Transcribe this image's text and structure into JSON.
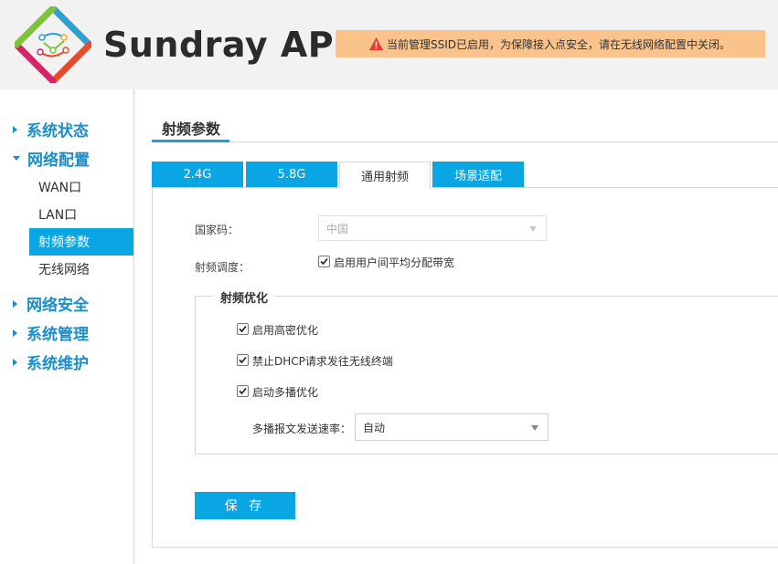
{
  "header": {
    "app_title": "Sundray AP",
    "warning_text": "当前管理SSID已启用，为保障接入点安全，请在无线网络配置中关闭。",
    "logo_icon": "sundray-logo-icon",
    "warning_icon": "warning-triangle-icon"
  },
  "sidebar": {
    "groups": [
      {
        "label": "系统状态",
        "expanded": false
      },
      {
        "label": "网络配置",
        "expanded": true
      },
      {
        "label": "网络安全",
        "expanded": false
      },
      {
        "label": "系统管理",
        "expanded": false
      },
      {
        "label": "系统维护",
        "expanded": false
      }
    ],
    "sub_items": [
      {
        "label": "WAN口",
        "active": false
      },
      {
        "label": "LAN口",
        "active": false
      },
      {
        "label": "射频参数",
        "active": true
      },
      {
        "label": "无线网络",
        "active": false
      }
    ]
  },
  "main": {
    "title": "射频参数",
    "tabs": [
      {
        "label": "2.4G",
        "selected": false
      },
      {
        "label": "5.8G",
        "selected": false
      },
      {
        "label": "通用射频",
        "selected": true
      },
      {
        "label": "场景适配",
        "selected": false
      }
    ],
    "form": {
      "country_label": "国家码：",
      "country_value": "中国",
      "scheduling_label": "射频调度：",
      "scheduling_checkbox": {
        "label": "启用用户间平均分配带宽",
        "checked": true
      },
      "optimization": {
        "legend": "射频优化",
        "options": [
          {
            "label": "启用高密优化",
            "checked": true
          },
          {
            "label": "禁止DHCP请求发往无线终端",
            "checked": true
          },
          {
            "label": "启动多播优化",
            "checked": true
          }
        ],
        "multicast_rate_label": "多播报文发送速率：",
        "multicast_rate_value": "自动"
      },
      "save_label": "保 存"
    }
  },
  "colors": {
    "accent": "#0aa6e3",
    "nav_text": "#1a8ec9",
    "warning_bg": "#f9c38b",
    "warning_icon": "#e8392b"
  }
}
